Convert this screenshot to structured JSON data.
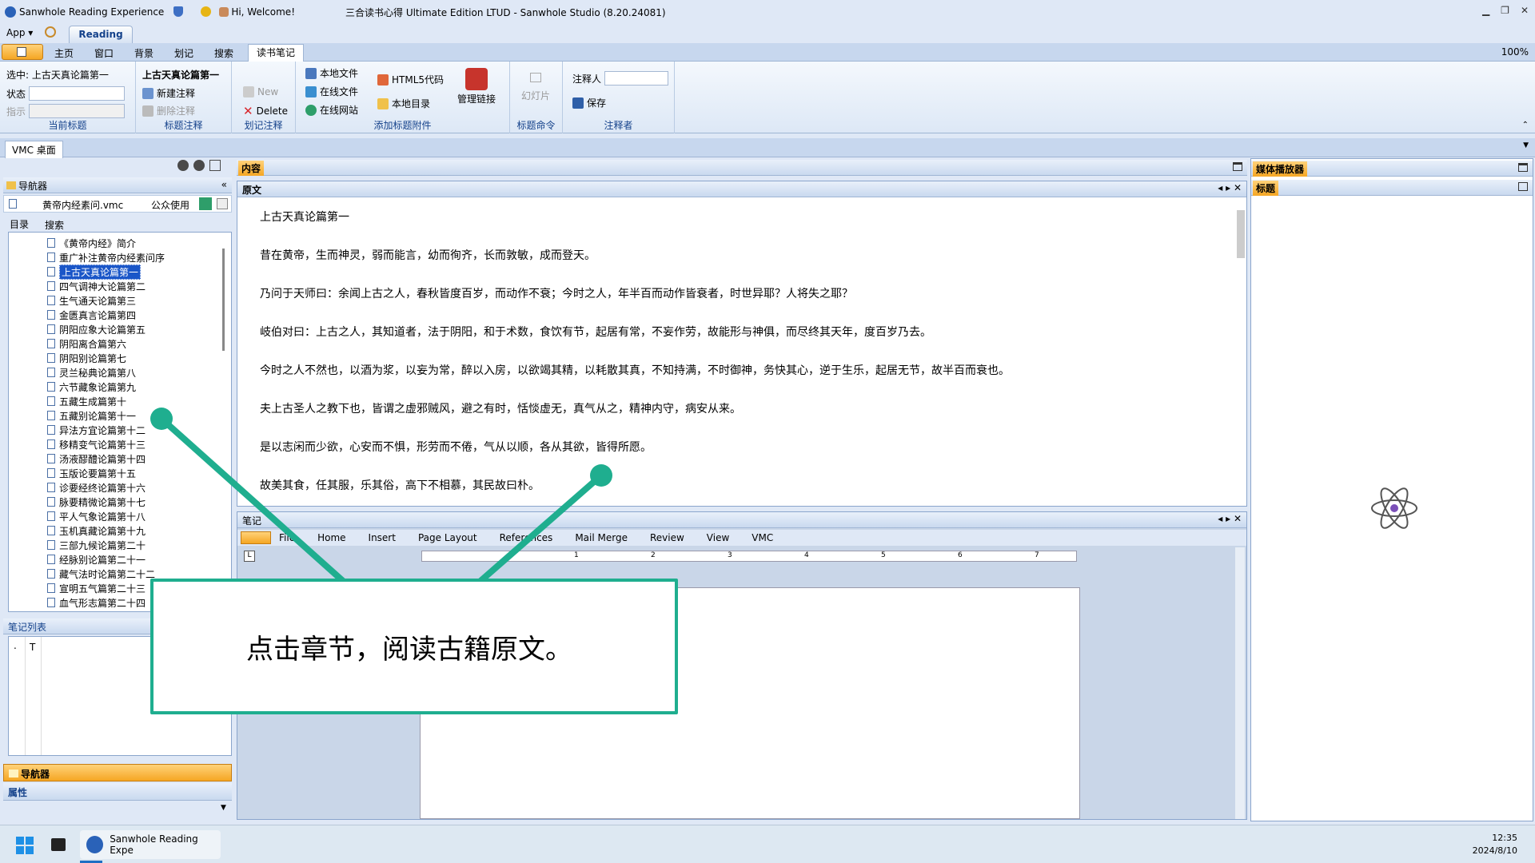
{
  "titlebar": {
    "brand": "Sanwhole Reading Experience",
    "welcome": "Hi, Welcome!",
    "app_title": "三合读书心得 Ultimate Edition LTUD - Sanwhole Studio (8.20.24081)"
  },
  "menu": {
    "app": "App",
    "reading_tab": "Reading",
    "tabs": [
      "主页",
      "窗口",
      "背景",
      "划记",
      "搜索",
      "读书笔记"
    ],
    "zoom": "100%"
  },
  "ribbon": {
    "current_title": {
      "selected": "选中: 上古天真论篇第一",
      "status_label": "状态",
      "indicator_label": "指示",
      "group": "当前标题"
    },
    "title_notes": {
      "name": "上古天真论篇第一",
      "new_note": "新建注释",
      "delete_note": "删除注释",
      "group": "标题注释"
    },
    "marks": {
      "new": "New",
      "delete": "Delete",
      "group": "划记注释"
    },
    "attach": {
      "local_file": "本地文件",
      "online_file": "在线文件",
      "online_site": "在线网站",
      "html5": "HTML5代码",
      "local_dir": "本地目录",
      "manage_links": "管理链接",
      "group": "添加标题附件"
    },
    "title_cmd": {
      "slideshow": "幻灯片",
      "group": "标题命令"
    },
    "annotator": {
      "label": "注释人",
      "save": "保存",
      "group": "注释者"
    }
  },
  "desk_tab": "VMC 桌面",
  "navigator": {
    "title": "导航器",
    "file": "黄帝内经素问.vmc",
    "public": "公众使用",
    "tabs": [
      "目录",
      "搜索"
    ],
    "items": [
      "《黄帝内经》简介",
      "重广补注黄帝内经素问序",
      "上古天真论篇第一",
      "四气调神大论篇第二",
      "生气通天论篇第三",
      "金匮真言论篇第四",
      "阴阳应象大论篇第五",
      "阴阳离合篇第六",
      "阴阳别论篇第七",
      "灵兰秘典论篇第八",
      "六节藏象论篇第九",
      "五藏生成篇第十",
      "五藏别论篇第十一",
      "异法方宜论篇第十二",
      "移精变气论篇第十三",
      "汤液醪醴论篇第十四",
      "玉版论要篇第十五",
      "诊要经终论篇第十六",
      "脉要精微论篇第十七",
      "平人气象论篇第十八",
      "玉机真藏论篇第十九",
      "三部九候论篇第二十",
      "经脉别论篇第二十一",
      "藏气法时论篇第二十二",
      "宣明五气篇第二十三",
      "血气形志篇第二十四"
    ],
    "selected_index": 2
  },
  "notes_list": {
    "title": "笔记列表",
    "col1": "T"
  },
  "bottom_nav": {
    "nav": "导航器",
    "props": "属性"
  },
  "content": {
    "header": "内容",
    "subtab": "原文",
    "paragraphs": [
      "上古天真论篇第一",
      "昔在黄帝，生而神灵，弱而能言，幼而徇齐，长而敦敏，成而登天。",
      "乃问于天师曰：余闻上古之人，春秋皆度百岁，而动作不衰；今时之人，年半百而动作皆衰者，时世异耶？人将失之耶？",
      "岐伯对曰：上古之人，其知道者，法于阴阳，和于术数，食饮有节，起居有常，不妄作劳，故能形与神俱，而尽终其天年，度百岁乃去。",
      "今时之人不然也，以酒为浆，以妄为常，醉以入房，以欲竭其精，以耗散其真，不知持满，不时御神，务快其心，逆于生乐，起居无节，故半百而衰也。",
      "夫上古圣人之教下也，皆谓之虚邪贼风，避之有时，恬惔虚无，真气从之，精神内守，病安从来。",
      "是以志闲而少欲，心安而不惧，形劳而不倦，气从以顺，各从其欲，皆得所愿。",
      "故美其食，任其服，乐其俗，高下不相慕，其民故曰朴。"
    ]
  },
  "notes_editor": {
    "tab": "笔记",
    "menu": [
      "File",
      "Home",
      "Insert",
      "Page Layout",
      "References",
      "Mail Merge",
      "Review",
      "View",
      "VMC"
    ],
    "ruler": [
      "1",
      "2",
      "3",
      "4",
      "5",
      "6",
      "7"
    ]
  },
  "media": {
    "header": "媒体播放器",
    "subtab": "标题"
  },
  "callout": {
    "text": "点击章节，阅读古籍原文。"
  },
  "taskbar": {
    "app": "Sanwhole Reading Expe",
    "time": "12:35",
    "date": "2024/8/10"
  },
  "colors": {
    "accent": "#1fae8f",
    "selection": "#1a56c8",
    "orange": "#f5a623"
  }
}
